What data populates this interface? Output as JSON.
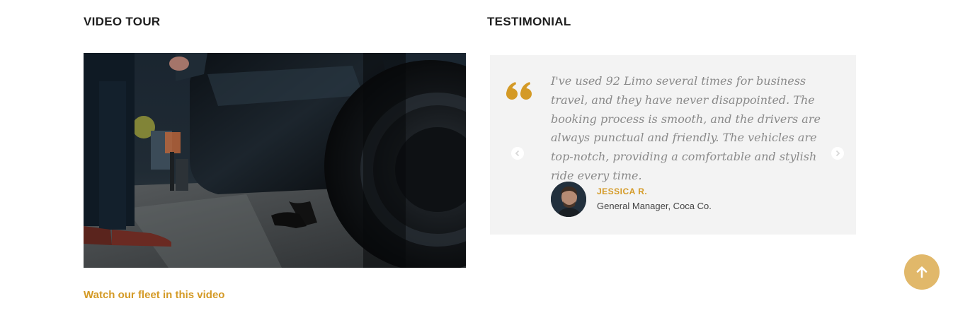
{
  "video_section": {
    "title": "VIDEO TOUR",
    "caption": "Watch our fleet in this video"
  },
  "testimonial_section": {
    "title": "TESTIMONIAL",
    "quote": "I've used 92 Limo several times for business travel, and they have never disappointed. The booking process is smooth, and the drivers are always punctual and friendly. The vehicles are top-notch, providing a comfortable and stylish ride every time.",
    "author_name": "JESSICA R.",
    "author_role": "General Manager, Coca Co.",
    "icons": {
      "quote": "quote-icon",
      "prev": "chevron-left-icon",
      "next": "chevron-right-icon"
    }
  },
  "back_to_top": {
    "icon": "arrow-up-icon"
  },
  "colors": {
    "accent": "#d49a26",
    "card_background": "#f3f3f3",
    "back_to_top": "#e1b86a",
    "quote_text": "#8a8a8a"
  }
}
